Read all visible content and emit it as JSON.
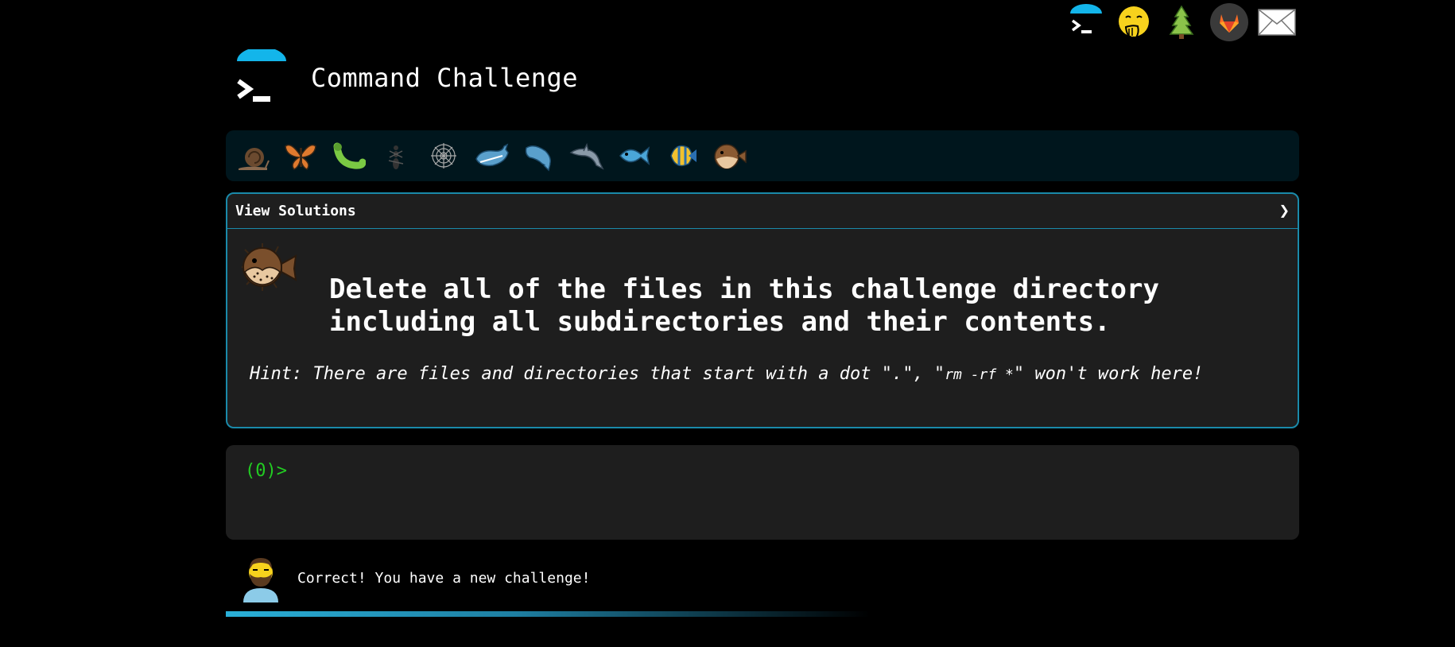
{
  "nav": {
    "icons": [
      "terminal-logo-icon",
      "face-with-hand-over-mouth-icon",
      "evergreen-tree-icon",
      "gitlab-icon",
      "envelope-icon"
    ]
  },
  "header": {
    "title": "Command Challenge"
  },
  "levels": {
    "icons": [
      "snail-icon",
      "butterfly-icon",
      "bug-icon",
      "ant-icon",
      "spider-web-icon",
      "whale-icon",
      "whale-spouting-icon",
      "dolphin-icon",
      "fish-icon",
      "tropical-fish-icon",
      "blowfish-icon"
    ]
  },
  "challenge": {
    "solutions_label": "View Solutions",
    "chevron": "❯",
    "description": "Delete all of the files in this challenge directory including all subdirectories and their contents.",
    "hint_prefix": "Hint: There are files and directories that start with a dot \".\", \"",
    "hint_code": "rm -rf *",
    "hint_suffix": "\" won't work here!"
  },
  "terminal": {
    "prompt": "(0)>"
  },
  "status": {
    "message": "Correct! You have a new challenge!"
  },
  "progress": {
    "fraction": 0.44
  },
  "colors": {
    "accent": "#1a8aaa",
    "prompt": "#22cc22",
    "panel": "#1e1e1e",
    "levels_bg": "#00161d"
  }
}
